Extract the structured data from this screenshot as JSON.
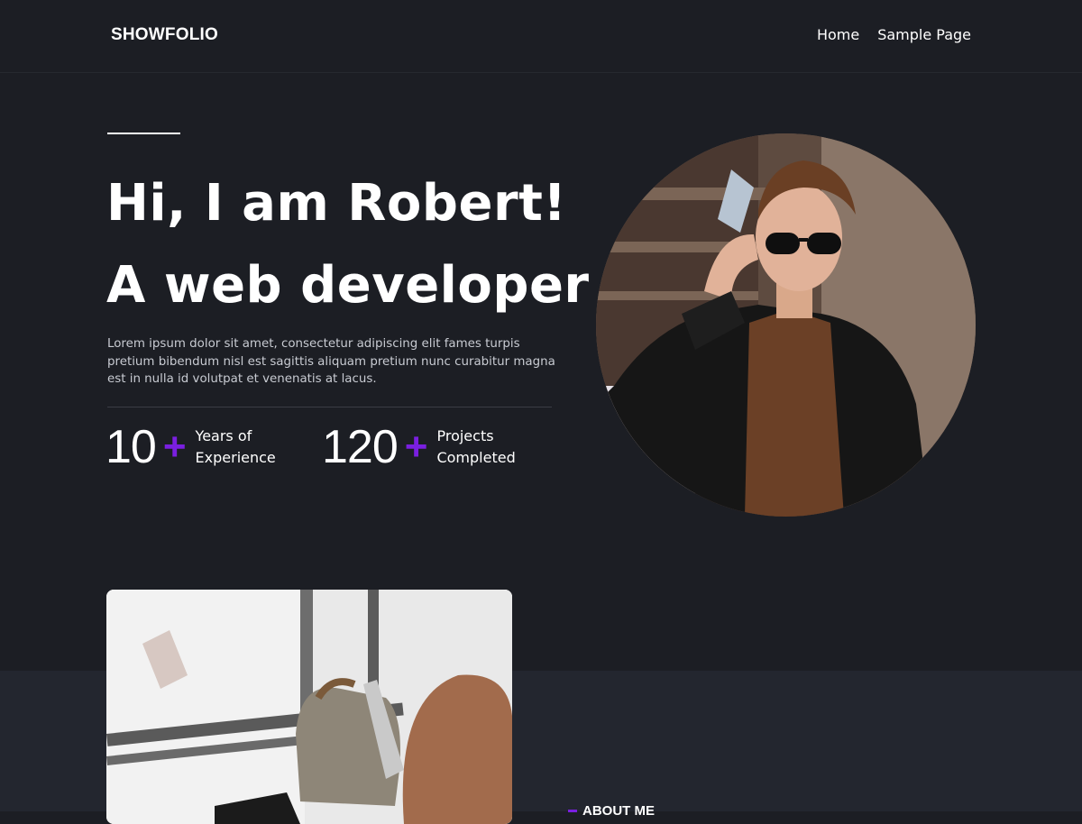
{
  "header": {
    "logo": "SHOWFOLIO",
    "nav": [
      {
        "label": "Home"
      },
      {
        "label": "Sample Page"
      }
    ]
  },
  "hero": {
    "title_line1": "Hi, I am Robert!",
    "title_line2": "A web developer",
    "description": "Lorem ipsum dolor sit amet, consectetur adipiscing elit fames turpis pretium bibendum nisl est sagittis aliquam pretium nunc curabitur magna est in nulla id volutpat et venenatis at lacus.",
    "stats": [
      {
        "number": "10",
        "plus": "+",
        "label_line1": "Years of",
        "label_line2": "Experience"
      },
      {
        "number": "120",
        "plus": "+",
        "label_line1": "Projects",
        "label_line2": "Completed"
      }
    ]
  },
  "about": {
    "label": "ABOUT ME"
  },
  "colors": {
    "background": "#1c1e24",
    "band": "#23262f",
    "accent": "#7a1fe0",
    "text": "#ffffff"
  }
}
